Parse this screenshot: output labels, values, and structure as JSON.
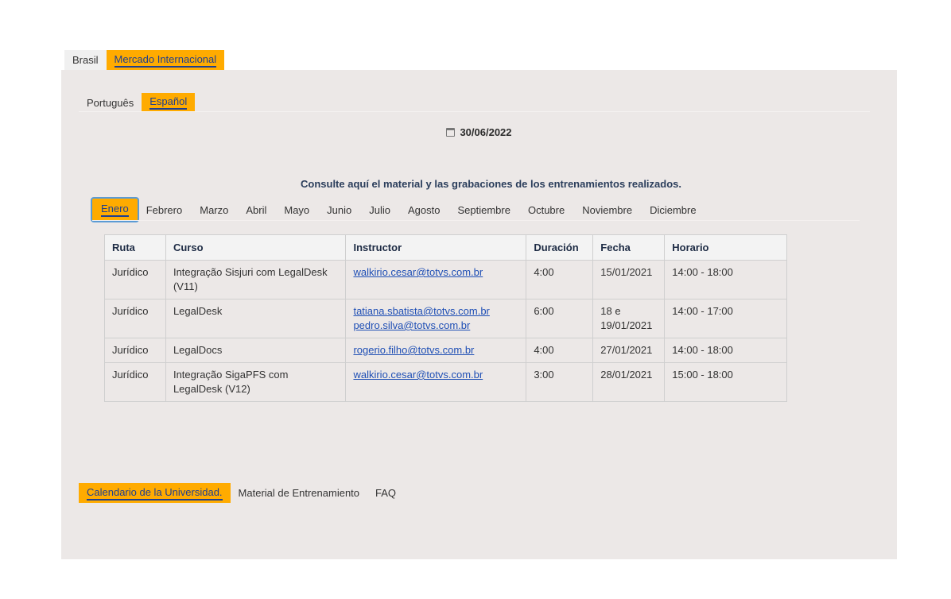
{
  "top_tabs": [
    "Brasil",
    "Mercado Internacional"
  ],
  "lang_tabs": [
    "Português",
    "Español"
  ],
  "date": "30/06/2022",
  "subtitle": "Consulte aquí el material y las grabaciones de los entrenamientos realizados.",
  "months": [
    "Enero",
    "Febrero",
    "Marzo",
    "Abril",
    "Mayo",
    "Junio",
    "Julio",
    "Agosto",
    "Septiembre",
    "Octubre",
    "Noviembre",
    "Diciembre"
  ],
  "table": {
    "headers": [
      "Ruta",
      "Curso",
      "Instructor",
      "Duración",
      "Fecha",
      "Horario"
    ],
    "rows": [
      {
        "ruta": "Jurídico",
        "curso": "Integração Sisjuri com LegalDesk (V11)",
        "instructor1": "walkirio.cesar@totvs.com.br",
        "instructor2": "",
        "duracion": "4:00",
        "fecha": "15/01/2021",
        "horario": "14:00 - 18:00"
      },
      {
        "ruta": "Jurídico",
        "curso": "LegalDesk",
        "instructor1": "tatiana.sbatista@totvs.com.br",
        "instructor2": "pedro.silva@totvs.com.br",
        "duracion": "6:00",
        "fecha": "18 e 19/01/2021",
        "horario": "14:00 - 17:00"
      },
      {
        "ruta": "Jurídico",
        "curso": "LegalDocs",
        "instructor1": "rogerio.filho@totvs.com.br",
        "instructor2": "",
        "duracion": "4:00",
        "fecha": "27/01/2021",
        "horario": "14:00 - 18:00"
      },
      {
        "ruta": "Jurídico",
        "curso": "Integração SigaPFS com LegalDesk (V12)",
        "instructor1": "walkirio.cesar@totvs.com.br",
        "instructor2": "",
        "duracion": "3:00",
        "fecha": "28/01/2021",
        "horario": "15:00 - 18:00"
      }
    ]
  },
  "bottom_tabs": [
    "Calendario de la Universidad.",
    "Material de Entrenamiento",
    "FAQ"
  ],
  "colors": {
    "accent": "#ffab00",
    "link": "#1f4fb5",
    "panel_bg": "#ece8e7"
  }
}
